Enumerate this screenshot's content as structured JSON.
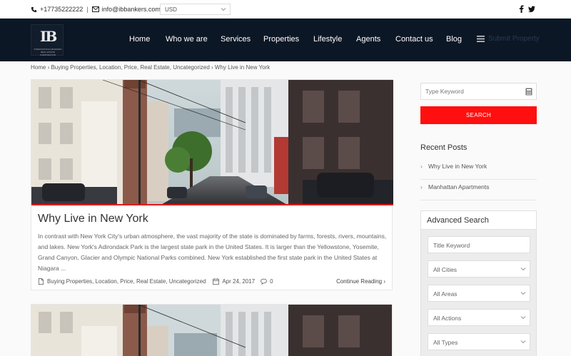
{
  "topbar": {
    "phone": "+17735222222",
    "separator": "|",
    "email": "info@ibbankers.com",
    "currency": "USD",
    "social": {
      "facebook": "f",
      "twitter": "twitter"
    }
  },
  "header": {
    "logo_mark": "IB",
    "logo_text": "INTERNATIONAL BANKERS REAL ESTATE CORPORATION",
    "nav": [
      "Home",
      "Who we are",
      "Services",
      "Properties",
      "Lifestyle",
      "Agents",
      "Contact us",
      "Blog"
    ],
    "submit_label": "Submit Property"
  },
  "breadcrumb": "Home › Buying Properties, Location, Price, Real Estate, Uncategorized › Why Live in New York",
  "post": {
    "title": "Why Live in New York",
    "excerpt": "In contrast with New York City's urban atmosphere, the vast majority of the state is dominated by farms, forests, rivers, mountains, and lakes. New York's Adirondack Park is the largest state park in the United States. It is larger than the Yellowstone, Yosemite, Grand Canyon, Glacier and Olympic National Parks combined. New York established the first state park in the United States at Niagara ...",
    "categories": "Buying Properties, Location, Price, Real Estate, Uncategorized",
    "date": "Apr 24, 2017",
    "comments": "0",
    "continue": "Continue Reading ›"
  },
  "sidebar": {
    "keyword_placeholder": "Type Keyword",
    "search_label": "SEARCH",
    "recent_title": "Recent Posts",
    "recent_arrow": "›",
    "recent": [
      "Why Live in New York",
      "Manhattan Apartments"
    ],
    "advanced": {
      "title": "Advanced Search",
      "title_placeholder": "Title Keyword",
      "cities": "All Cities",
      "areas": "All Areas",
      "actions": "All Actions",
      "types": "All Types"
    }
  },
  "colors": {
    "header_bg": "#0c1726",
    "accent_red": "#ff0f0f"
  }
}
